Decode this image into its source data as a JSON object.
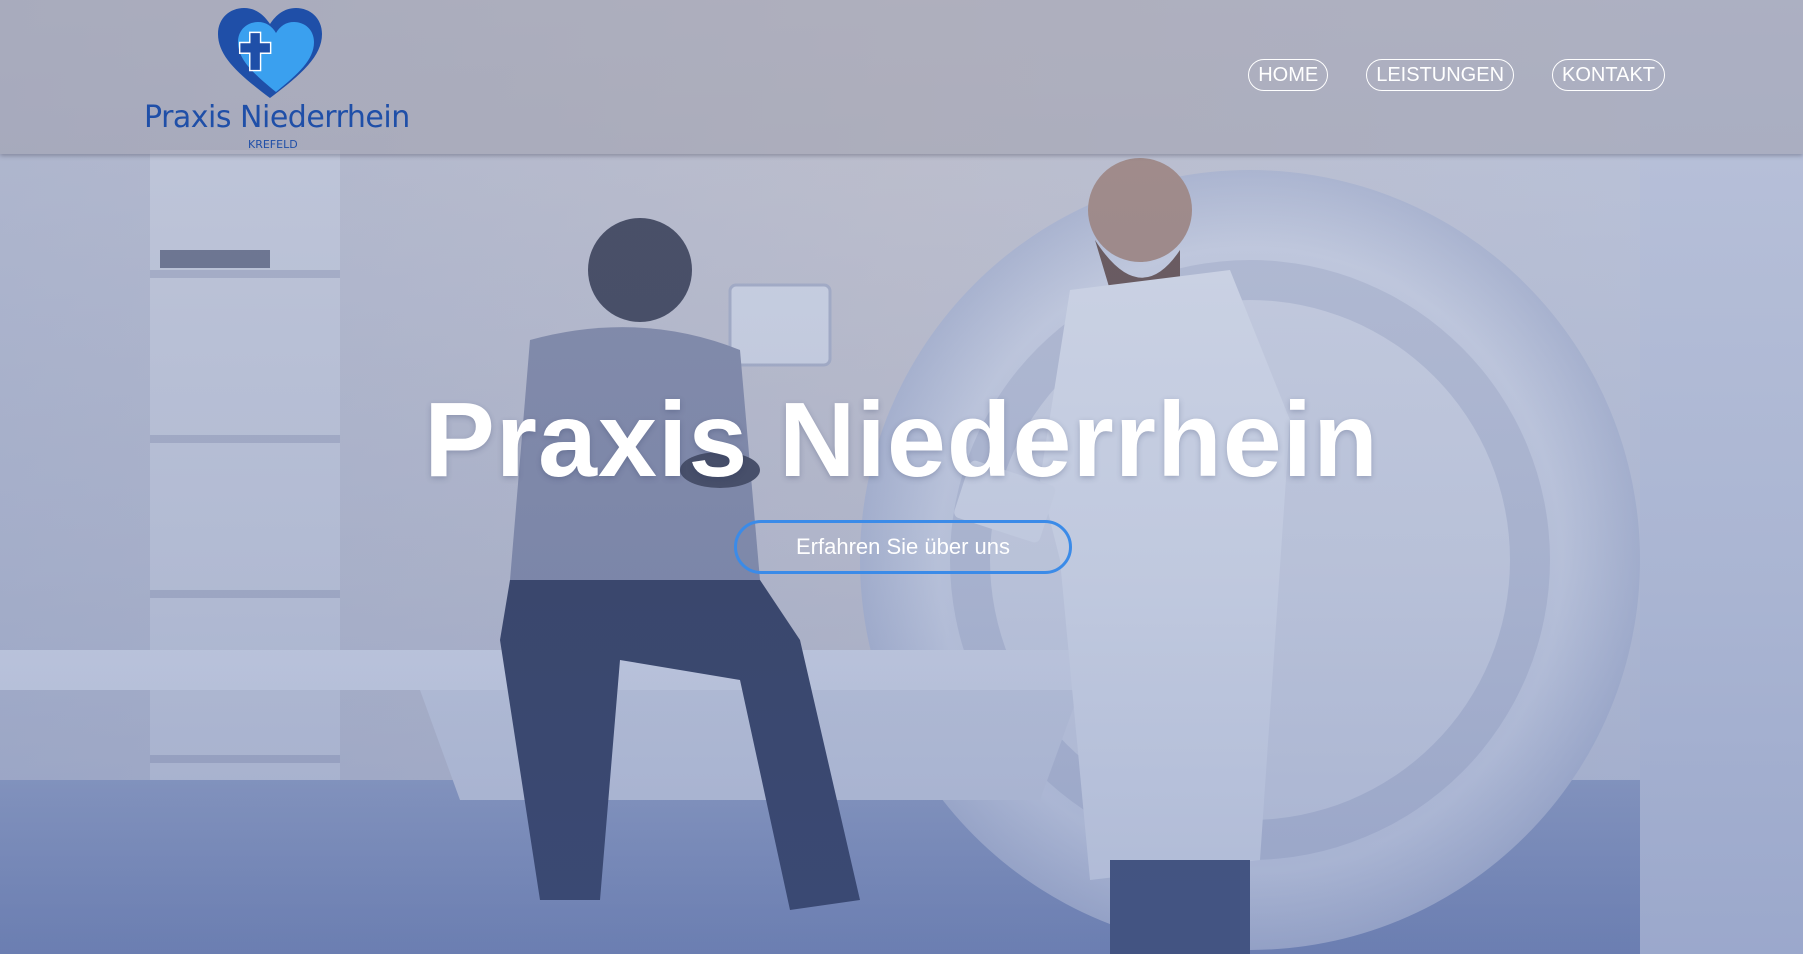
{
  "brand": {
    "name": "Praxis Niederrhein",
    "location": "KREFELD",
    "logo_icon": "heart-cross-icon",
    "colors": {
      "dark_blue": "#1f4fa8",
      "light_blue": "#3aa0ef"
    }
  },
  "nav": {
    "items": [
      {
        "label": "HOME"
      },
      {
        "label": "LEISTUNGEN"
      },
      {
        "label": "KONTAKT"
      }
    ]
  },
  "hero": {
    "title": "Praxis Niederrhein",
    "cta_label": "Erfahren Sie über uns",
    "cta_border_color": "#3b8be8"
  }
}
